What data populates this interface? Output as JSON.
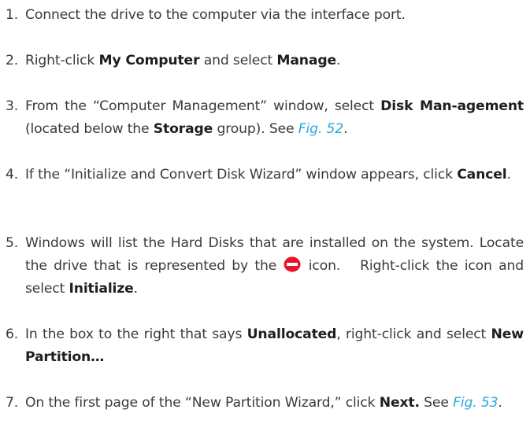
{
  "colors": {
    "text": "#3a3a3a",
    "bold": "#1e1e1e",
    "link": "#29a8df",
    "icon": "#e8142a"
  },
  "steps": [
    {
      "number": "1.",
      "t1": "Connect the drive to the computer via the interface port."
    },
    {
      "number": "2.",
      "t1": "Right-click ",
      "b1": "My Computer",
      "t2": " and select ",
      "b2": "Manage",
      "t3": "."
    },
    {
      "number": "3.",
      "t1": "From the “Computer Management” window, select ",
      "b1": "Disk Man-agement",
      "t2": " (located below the ",
      "b2": "Storage",
      "t3": " group). See ",
      "link": "Fig. 52",
      "t4": "."
    },
    {
      "number": "4.",
      "t1": "If the “Initialize and Convert Disk Wizard” window appears, click ",
      "b1": "Cancel",
      "t2": "."
    },
    {
      "number": "5.",
      "t1": "Windows will list the Hard Disks that are installed on the system. Locate the drive that is represented by the ",
      "icon": "stop-disk-icon",
      "t2": " icon.   Right-click the icon and select ",
      "b1": "Initialize",
      "t3": "."
    },
    {
      "number": "6.",
      "t1": "In the box to the right that says ",
      "b1": "Unallocated",
      "t2": ", right-click and select ",
      "b2": "New Partition…"
    },
    {
      "number": "7.",
      "t1": "On the first page of the “New Partition Wizard,” click ",
      "b1": "Next.",
      "t2": " See ",
      "link": "Fig. 53",
      "t3": "."
    }
  ]
}
